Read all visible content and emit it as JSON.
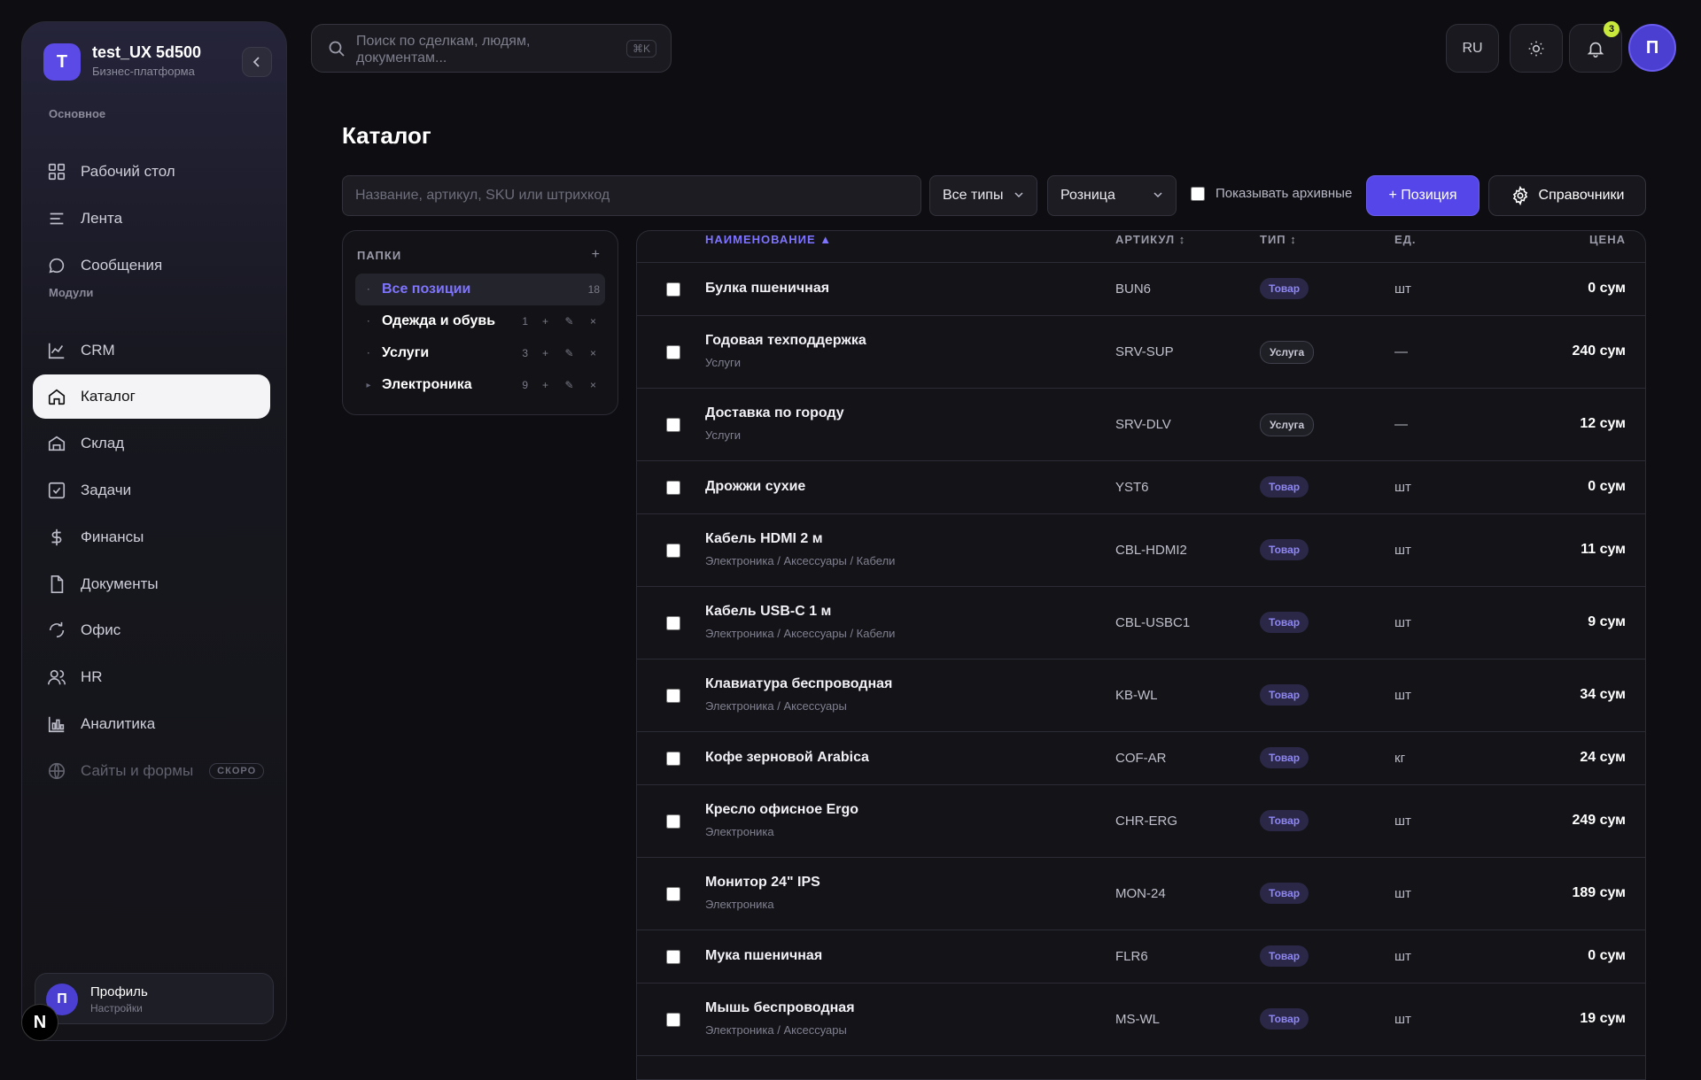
{
  "sidebar": {
    "brand": {
      "logo_letter": "T",
      "name": "test_UX 5d500",
      "subtitle": "Бизнес-платформа"
    },
    "section_main": "Основное",
    "section_modules": "Модули",
    "items": [
      {
        "label": "Рабочий стол",
        "icon": "dashboard-icon"
      },
      {
        "label": "Лента",
        "icon": "feed-icon"
      },
      {
        "label": "Сообщения",
        "icon": "message-icon"
      },
      {
        "label": "CRM",
        "icon": "chart-line-icon"
      },
      {
        "label": "Каталог",
        "icon": "home-icon",
        "active": true
      },
      {
        "label": "Склад",
        "icon": "warehouse-icon"
      },
      {
        "label": "Задачи",
        "icon": "task-check-icon"
      },
      {
        "label": "Финансы",
        "icon": "dollar-icon"
      },
      {
        "label": "Документы",
        "icon": "document-icon"
      },
      {
        "label": "Офис",
        "icon": "office-icon"
      },
      {
        "label": "HR",
        "icon": "users-icon"
      },
      {
        "label": "Аналитика",
        "icon": "bar-chart-icon"
      },
      {
        "label": "Сайты и формы",
        "icon": "globe-icon",
        "disabled": true,
        "badge": "СКОРО"
      }
    ],
    "profile": {
      "initial": "П",
      "name": "Профиль",
      "subtitle": "Настройки"
    },
    "dev_badge": "N"
  },
  "topbar": {
    "search_placeholder": "Поиск по сделкам, людям, документам...",
    "search_shortcut": "⌘K",
    "lang": "RU",
    "notifications_count": "3",
    "user_initial": "П"
  },
  "page": {
    "title": "Каталог",
    "filter_placeholder": "Название, артикул, SKU или штрихкод",
    "type_select": "Все типы",
    "price_select": "Розница",
    "archive_label": "Показывать архивные",
    "add_button": "+ Позиция",
    "refs_button": "Справочники"
  },
  "folders": {
    "title": "ПАПКИ",
    "add": "+",
    "items": [
      {
        "name": "Все позиции",
        "count": "18",
        "active": true
      },
      {
        "name": "Одежда и обувь",
        "count": "1"
      },
      {
        "name": "Услуги",
        "count": "3"
      },
      {
        "name": "Электроника",
        "count": "9",
        "expandable": true
      }
    ],
    "actions": {
      "add": "+",
      "edit": "✎",
      "delete": "×"
    }
  },
  "table": {
    "columns": {
      "name": "НАИМЕНОВАНИЕ ▲",
      "sku": "АРТИКУЛ ↕",
      "type": "ТИП ↕",
      "unit": "ЕД.",
      "price": "ЦЕНА"
    },
    "rows": [
      {
        "name": "Булка пшеничная",
        "path": "",
        "sku": "BUN6",
        "type": "Товар",
        "unit": "шт",
        "price": "0 сум"
      },
      {
        "name": "Годовая техподдержка",
        "path": "Услуги",
        "sku": "SRV-SUP",
        "type": "Услуга",
        "unit": "—",
        "price": "240 сум"
      },
      {
        "name": "Доставка по городу",
        "path": "Услуги",
        "sku": "SRV-DLV",
        "type": "Услуга",
        "unit": "—",
        "price": "12 сум"
      },
      {
        "name": "Дрожжи сухие",
        "path": "",
        "sku": "YST6",
        "type": "Товар",
        "unit": "шт",
        "price": "0 сум"
      },
      {
        "name": "Кабель HDMI 2 м",
        "path": "Электроника / Аксессуары / Кабели",
        "sku": "CBL-HDMI2",
        "type": "Товар",
        "unit": "шт",
        "price": "11 сум"
      },
      {
        "name": "Кабель USB-C 1 м",
        "path": "Электроника / Аксессуары / Кабели",
        "sku": "CBL-USBC1",
        "type": "Товар",
        "unit": "шт",
        "price": "9 сум"
      },
      {
        "name": "Клавиатура беспроводная",
        "path": "Электроника / Аксессуары",
        "sku": "KB-WL",
        "type": "Товар",
        "unit": "шт",
        "price": "34 сум"
      },
      {
        "name": "Кофе зерновой Arabica",
        "path": "",
        "sku": "COF-AR",
        "type": "Товар",
        "unit": "кг",
        "price": "24 сум"
      },
      {
        "name": "Кресло офисное Ergo",
        "path": "Электроника",
        "sku": "CHR-ERG",
        "type": "Товар",
        "unit": "шт",
        "price": "249 сум"
      },
      {
        "name": "Монитор 24\" IPS",
        "path": "Электроника",
        "sku": "MON-24",
        "type": "Товар",
        "unit": "шт",
        "price": "189 сум"
      },
      {
        "name": "Мука пшеничная",
        "path": "",
        "sku": "FLR6",
        "type": "Товар",
        "unit": "шт",
        "price": "0 сум"
      },
      {
        "name": "Мышь беспроводная",
        "path": "Электроника / Аксессуары",
        "sku": "MS-WL",
        "type": "Товар",
        "unit": "шт",
        "price": "19 сум"
      }
    ]
  },
  "colors": {
    "accent": "#5446e8",
    "accent_text": "#7f74ff",
    "notif": "#c9ea3c"
  }
}
